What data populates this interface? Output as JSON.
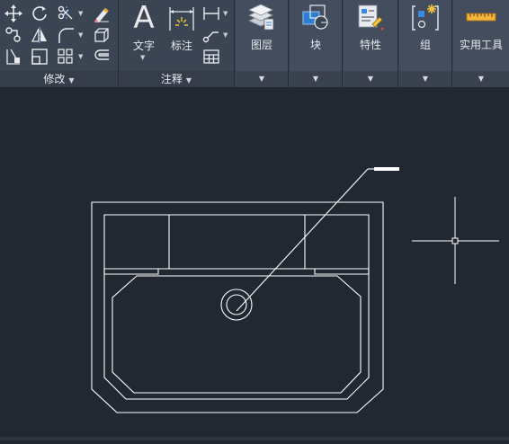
{
  "ribbon": {
    "modify_panel": {
      "title": "修改"
    },
    "annotation_panel": {
      "title": "注释",
      "text_label": "文字",
      "dimension_label": "标注"
    },
    "layers": {
      "label": "图层"
    },
    "block": {
      "label": "块"
    },
    "properties": {
      "label": "特性"
    },
    "group": {
      "label": "组"
    },
    "utilities": {
      "label": "实用工具"
    }
  },
  "colors": {
    "ribbon_bg": "#3b4453",
    "canvas_bg": "#222831",
    "geometry": "#ffffff"
  }
}
